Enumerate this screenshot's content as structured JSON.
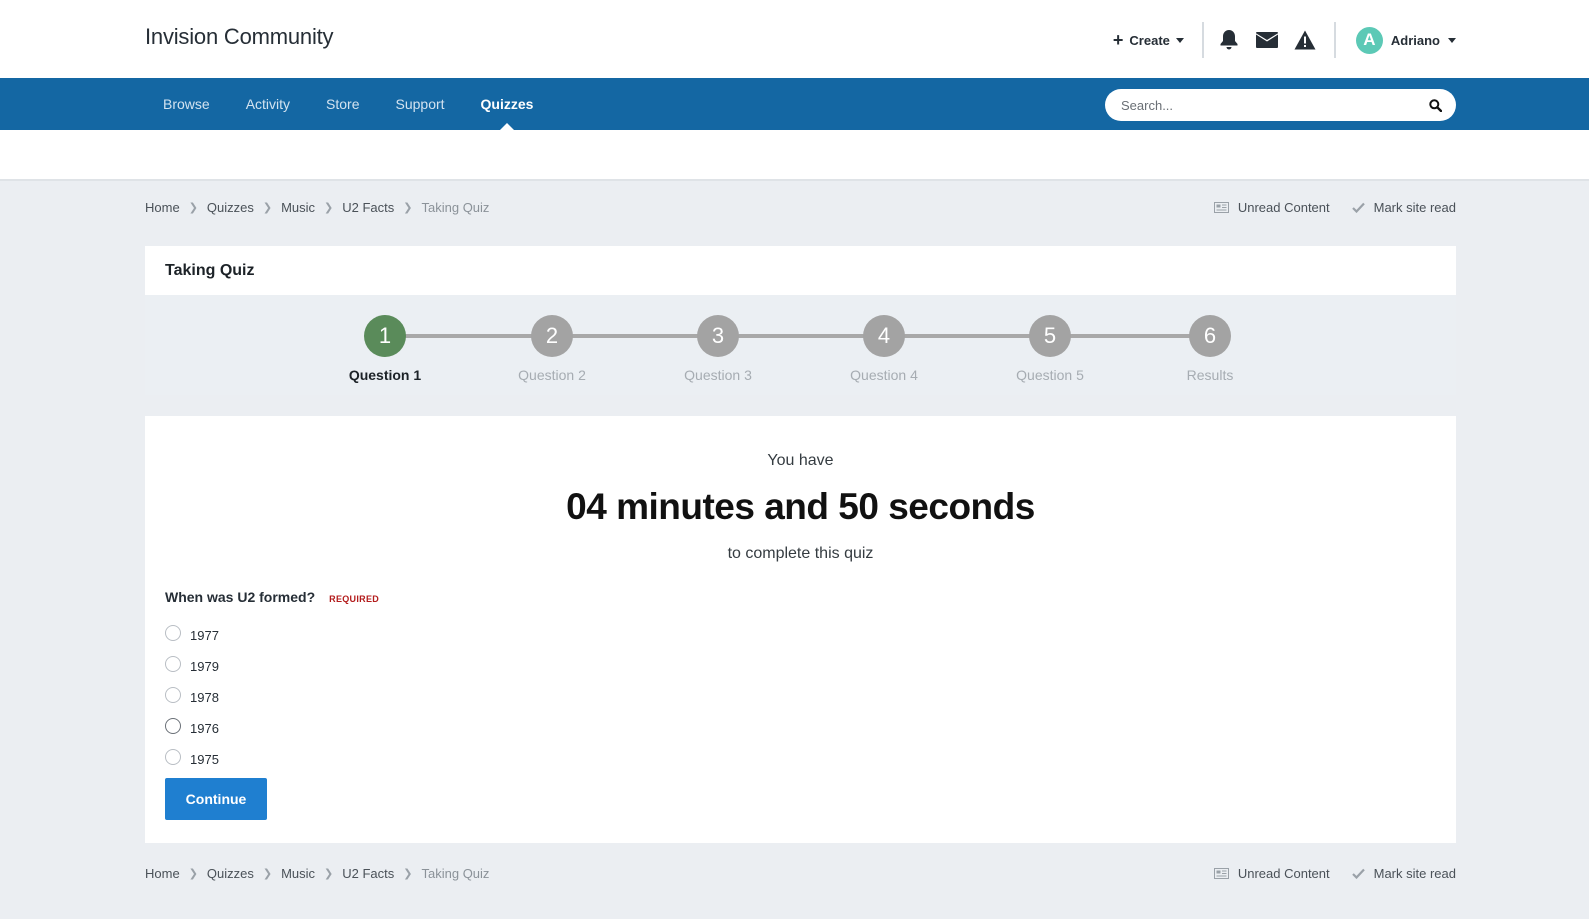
{
  "site": {
    "title": "Invision Community"
  },
  "userbar": {
    "create_label": "Create",
    "username": "Adriano",
    "avatar_letter": "A",
    "icons": [
      "bell-icon",
      "envelope-icon",
      "warning-icon"
    ]
  },
  "nav": {
    "items": [
      {
        "label": "Browse",
        "active": false
      },
      {
        "label": "Activity",
        "active": false
      },
      {
        "label": "Store",
        "active": false
      },
      {
        "label": "Support",
        "active": false
      },
      {
        "label": "Quizzes",
        "active": true
      }
    ]
  },
  "search": {
    "placeholder": "Search..."
  },
  "breadcrumb": {
    "items": [
      "Home",
      "Quizzes",
      "Music",
      "U2 Facts"
    ],
    "current": "Taking Quiz",
    "unread_label": "Unread Content",
    "mark_read_label": "Mark site read"
  },
  "quiz": {
    "title": "Taking Quiz",
    "steps": [
      {
        "number": "1",
        "label": "Question 1",
        "active": true
      },
      {
        "number": "2",
        "label": "Question 2",
        "active": false
      },
      {
        "number": "3",
        "label": "Question 3",
        "active": false
      },
      {
        "number": "4",
        "label": "Question 4",
        "active": false
      },
      {
        "number": "5",
        "label": "Question 5",
        "active": false
      },
      {
        "number": "6",
        "label": "Results",
        "active": false
      }
    ],
    "timer_pre": "You have",
    "timer_main": "04 minutes and 50 seconds",
    "timer_post": "to complete this quiz",
    "question": "When was U2 formed?",
    "required_label": "REQUIRED",
    "options": [
      "1977",
      "1979",
      "1978",
      "1976",
      "1975"
    ],
    "continue_label": "Continue"
  },
  "colors": {
    "nav_bg": "#1467a3",
    "active_step": "#5a8b5a",
    "inactive_step": "#a3a3a3",
    "button": "#1f7fd0",
    "required": "#b31b1b"
  }
}
